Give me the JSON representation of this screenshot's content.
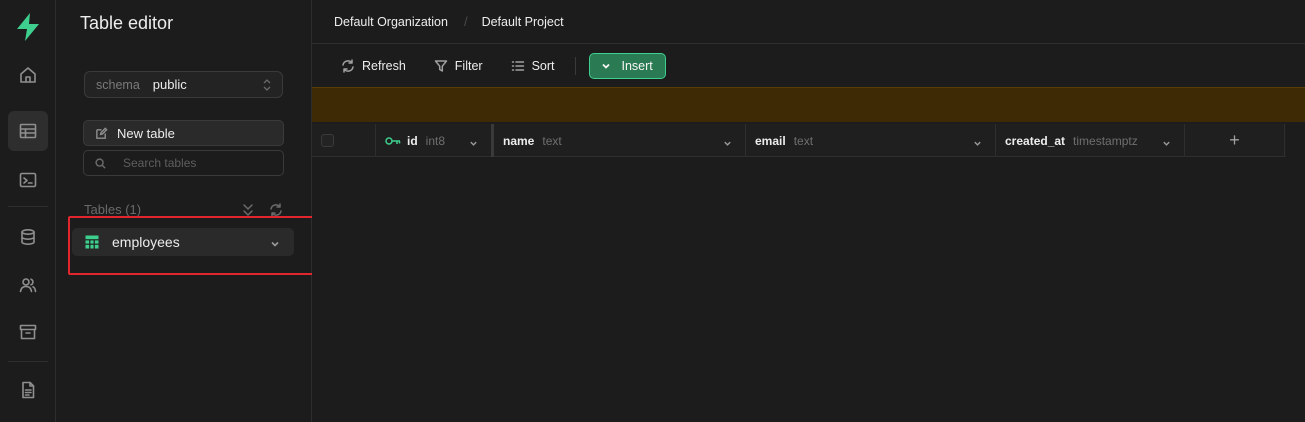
{
  "app": {
    "brand_color": "#3ecf8e",
    "rail_icons": [
      "home-icon",
      "table-editor-icon",
      "sql-editor-icon",
      "database-icon",
      "auth-users-icon",
      "storage-icon",
      "docs-icon"
    ]
  },
  "sidebar": {
    "title": "Table editor",
    "schema": {
      "label": "schema",
      "value": "public"
    },
    "new_table_label": "New table",
    "search_placeholder": "Search tables",
    "tables_header": "Tables (1)",
    "tables": [
      {
        "name": "employees"
      }
    ]
  },
  "breadcrumb": {
    "organization": "Default Organization",
    "separator": "/",
    "project": "Default Project"
  },
  "toolbar": {
    "refresh_label": "Refresh",
    "filter_label": "Filter",
    "sort_label": "Sort",
    "insert_label": "Insert"
  },
  "grid": {
    "columns": [
      {
        "name": "id",
        "type": "int8",
        "primary_key": true
      },
      {
        "name": "name",
        "type": "text"
      },
      {
        "name": "email",
        "type": "text"
      },
      {
        "name": "created_at",
        "type": "timestamptz"
      }
    ],
    "add_column_label": "+"
  },
  "colors": {
    "warning_bar": "#3e2a05",
    "insert_button": "#2a7a53",
    "highlight": "#e1262d"
  }
}
